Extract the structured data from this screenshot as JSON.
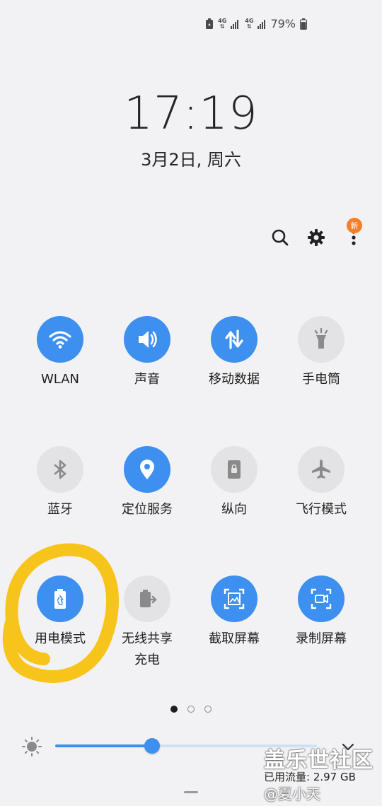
{
  "status_bar": {
    "net1_label": "4G",
    "net2_label": "4G",
    "battery_percent": "79%",
    "battery_level": 0.79
  },
  "lock": {
    "time": "17:19",
    "date": "3月2日, 周六"
  },
  "actions": {
    "search_icon": "search-icon",
    "settings_icon": "gear-icon",
    "more_icon": "more-vertical-icon",
    "badge": "新"
  },
  "tiles": [
    {
      "label": "WLAN",
      "icon": "wifi-icon",
      "state": "on"
    },
    {
      "label": "声音",
      "icon": "volume-icon",
      "state": "on"
    },
    {
      "label": "移动数据",
      "icon": "mobile-data-icon",
      "state": "on"
    },
    {
      "label": "手电筒",
      "icon": "flashlight-icon",
      "state": "off"
    },
    {
      "label": "蓝牙",
      "icon": "bluetooth-icon",
      "state": "off"
    },
    {
      "label": "定位服务",
      "icon": "location-icon",
      "state": "on"
    },
    {
      "label": "纵向",
      "icon": "portrait-lock-icon",
      "state": "off"
    },
    {
      "label": "飞行模式",
      "icon": "airplane-icon",
      "state": "off"
    },
    {
      "label": "用电模式",
      "icon": "battery-saver-icon",
      "state": "on"
    },
    {
      "label": "无线共享\n充电",
      "icon": "wireless-powershare-icon",
      "state": "off"
    },
    {
      "label": "截取屏幕",
      "icon": "screenshot-icon",
      "state": "on"
    },
    {
      "label": "录制屏幕",
      "icon": "screen-record-icon",
      "state": "on"
    }
  ],
  "pager": {
    "current": 1,
    "total": 3
  },
  "brightness": {
    "level": 0.37,
    "icon": "sun-icon",
    "expand_icon": "chevron-down-icon"
  },
  "watermark": {
    "title": "盖乐世社区",
    "data_usage": "已用流量: 2.97 GB",
    "user": "@夏小天"
  },
  "colors": {
    "accent": "#3d8ff0",
    "tile_off": "#e3e3e5",
    "badge": "#f77f2a",
    "annotation": "#f7c41b"
  }
}
